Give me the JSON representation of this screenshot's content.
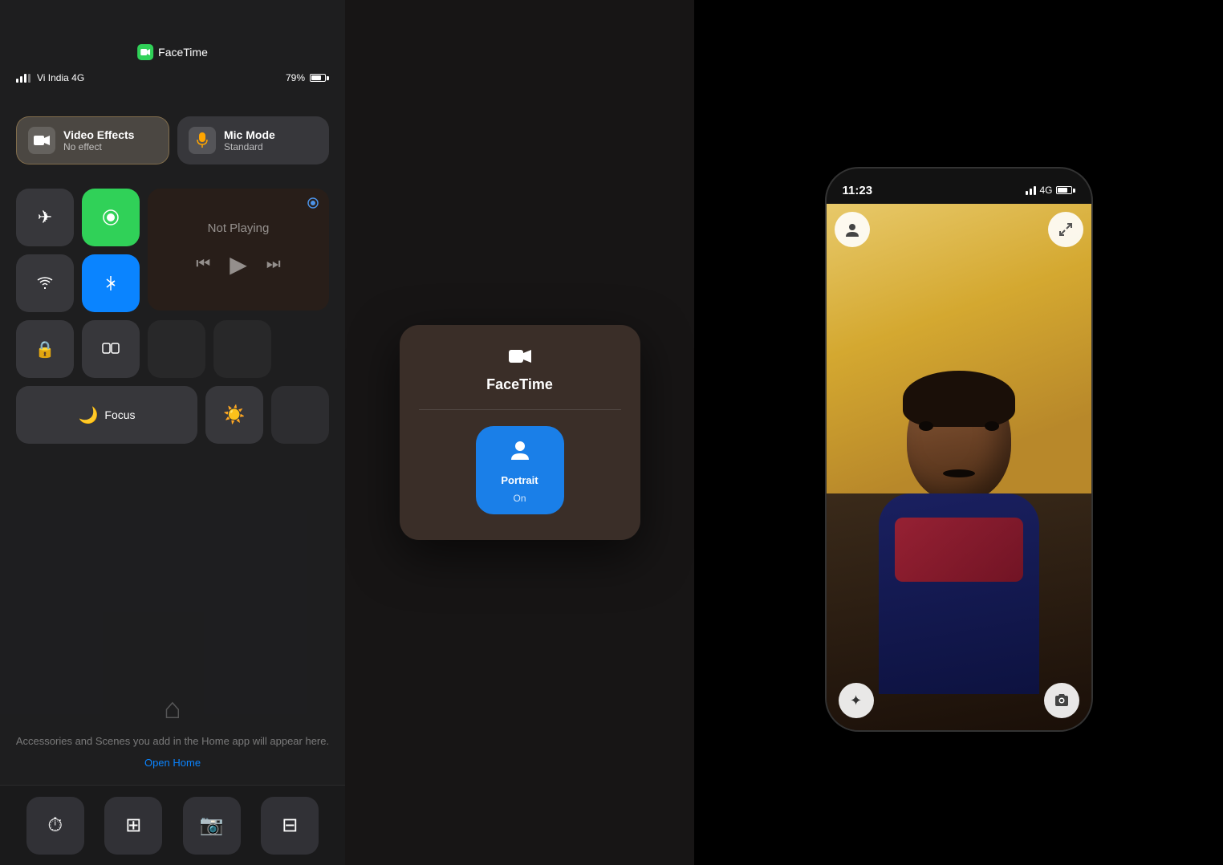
{
  "panel_left": {
    "facetime_label": "FaceTime",
    "carrier": "Vi India 4G",
    "battery_pct": "79%",
    "video_effects_label": "Video Effects",
    "video_effects_sub": "No effect",
    "mic_mode_label": "Mic Mode",
    "mic_mode_sub": "Standard",
    "not_playing": "Not Playing",
    "focus_label": "Focus",
    "home_text": "Accessories and Scenes you add in the Home app will appear here.",
    "open_home": "Open Home"
  },
  "panel_mid": {
    "title": "FaceTime",
    "portrait_label": "Portrait",
    "portrait_status": "On"
  },
  "panel_right": {
    "time": "11:23",
    "carrier": "4G"
  },
  "icons": {
    "airplane": "✈",
    "wifi_fill": "📶",
    "bluetooth": "⌁",
    "moon": "🌙",
    "home": "⌂",
    "clock": "⏱",
    "calc": "⊞",
    "camera": "⊙",
    "qr": "⊟",
    "lock": "🔒",
    "mirror": "⧉",
    "sun": "☀",
    "person": "♟",
    "star": "✦",
    "camera_snap": "📷"
  }
}
